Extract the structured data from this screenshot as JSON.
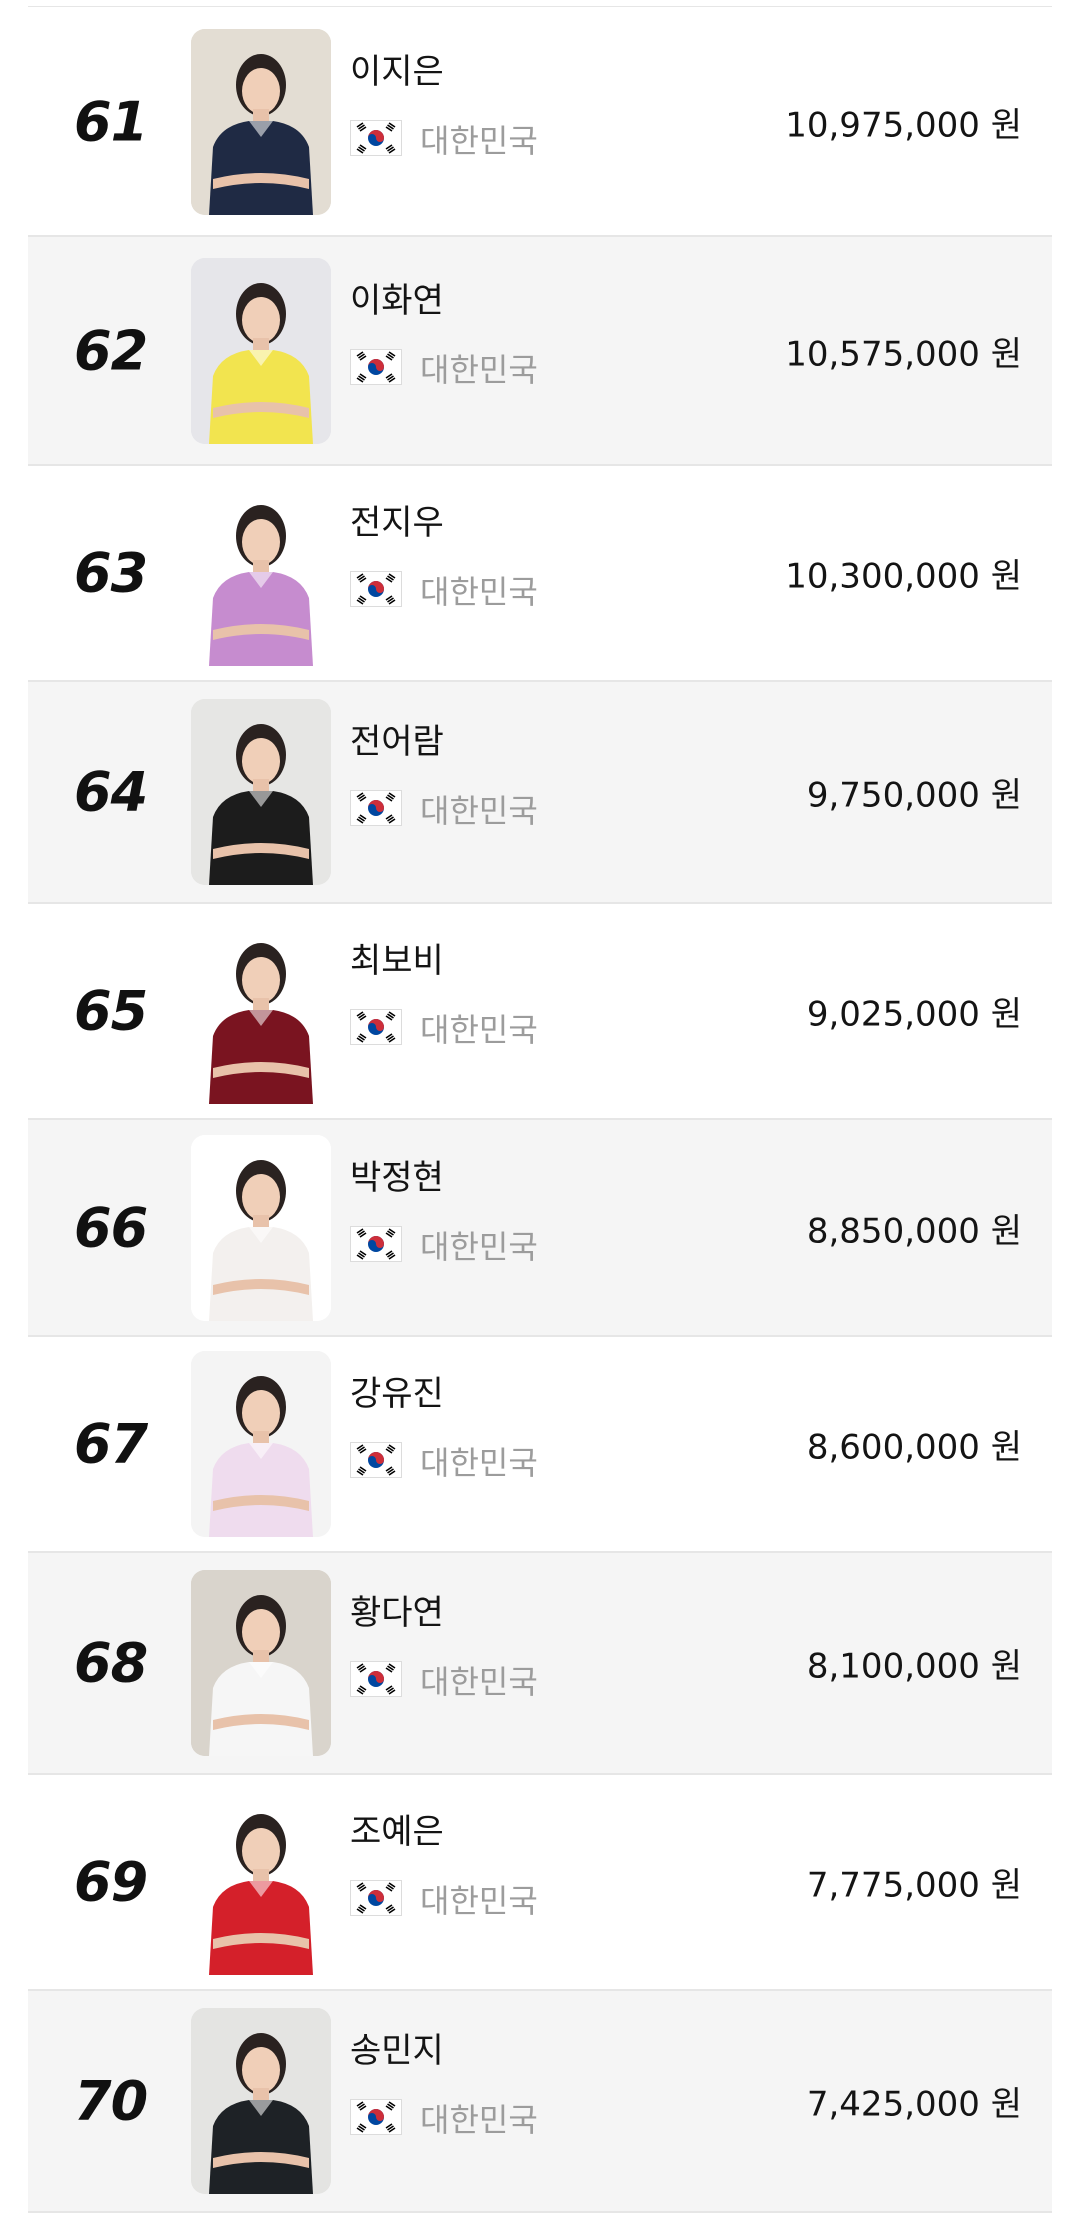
{
  "players": [
    {
      "rank": "61",
      "name": "이지은",
      "country": "대한민국",
      "prize": "10,975,000 원",
      "shirt": "#1f2a44",
      "bg": "#e3ddd3"
    },
    {
      "rank": "62",
      "name": "이화연",
      "country": "대한민국",
      "prize": "10,575,000 원",
      "shirt": "#f2e44f",
      "bg": "#e6e6ea"
    },
    {
      "rank": "63",
      "name": "전지우",
      "country": "대한민국",
      "prize": "10,300,000 원",
      "shirt": "#c68ccf",
      "bg": "#ffffff"
    },
    {
      "rank": "64",
      "name": "전어람",
      "country": "대한민국",
      "prize": "9,750,000 원",
      "shirt": "#1c1c1c",
      "bg": "#e6e6e4"
    },
    {
      "rank": "65",
      "name": "최보비",
      "country": "대한민국",
      "prize": "9,025,000 원",
      "shirt": "#7a1420",
      "bg": "#ffffff"
    },
    {
      "rank": "66",
      "name": "박정현",
      "country": "대한민국",
      "prize": "8,850,000 원",
      "shirt": "#f3f0ee",
      "bg": "#ffffff"
    },
    {
      "rank": "67",
      "name": "강유진",
      "country": "대한민국",
      "prize": "8,600,000 원",
      "shirt": "#efdcee",
      "bg": "#f4f4f4"
    },
    {
      "rank": "68",
      "name": "황다연",
      "country": "대한민국",
      "prize": "8,100,000 원",
      "shirt": "#f6f6f6",
      "bg": "#d9d4cc"
    },
    {
      "rank": "69",
      "name": "조예은",
      "country": "대한민국",
      "prize": "7,775,000 원",
      "shirt": "#d4202a",
      "bg": "#ffffff"
    },
    {
      "rank": "70",
      "name": "송민지",
      "country": "대한민국",
      "prize": "7,425,000 원",
      "shirt": "#1e2226",
      "bg": "#e4e4e2"
    }
  ],
  "icons": {
    "flag": "south-korea-flag-icon"
  }
}
